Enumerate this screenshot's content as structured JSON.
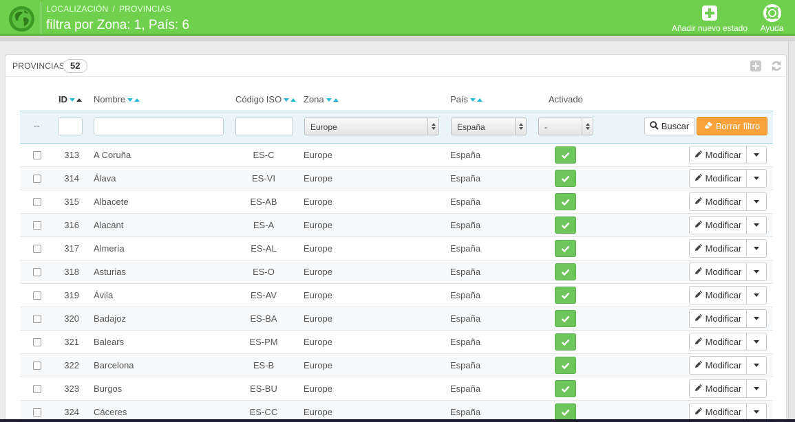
{
  "header": {
    "breadcrumb": [
      "LOCALIZACIÓN",
      "PROVINCIAS"
    ],
    "breadcrumb_sep": "/",
    "title": "filtra por Zona: 1, País: 6",
    "add_label": "Añadir nuevo estado",
    "help_label": "Ayuda",
    "logo_icon": "globe-icon",
    "color": "#6fd04d"
  },
  "panel": {
    "title": "PROVINCIAS",
    "count": "52"
  },
  "table": {
    "headers": {
      "id": "ID",
      "name": "Nombre",
      "iso": "Código ISO",
      "zone": "Zona",
      "country": "País",
      "active": "Activado"
    },
    "filters": {
      "bulk": "--",
      "id": "",
      "name": "",
      "iso": "",
      "zone": "Europe",
      "country": "España",
      "active": "-",
      "search_label": "Buscar",
      "reset_label": "Borrar filtro"
    },
    "edit_label": "Modificar",
    "rows": [
      {
        "id": "313",
        "name": "A Coruña",
        "iso": "ES-C",
        "zone": "Europe",
        "country": "España",
        "active": true
      },
      {
        "id": "314",
        "name": "Álava",
        "iso": "ES-VI",
        "zone": "Europe",
        "country": "España",
        "active": true
      },
      {
        "id": "315",
        "name": "Albacete",
        "iso": "ES-AB",
        "zone": "Europe",
        "country": "España",
        "active": true
      },
      {
        "id": "316",
        "name": "Alacant",
        "iso": "ES-A",
        "zone": "Europe",
        "country": "España",
        "active": true
      },
      {
        "id": "317",
        "name": "Almería",
        "iso": "ES-AL",
        "zone": "Europe",
        "country": "España",
        "active": true
      },
      {
        "id": "318",
        "name": "Asturias",
        "iso": "ES-O",
        "zone": "Europe",
        "country": "España",
        "active": true
      },
      {
        "id": "319",
        "name": "Ávila",
        "iso": "ES-AV",
        "zone": "Europe",
        "country": "España",
        "active": true
      },
      {
        "id": "320",
        "name": "Badajoz",
        "iso": "ES-BA",
        "zone": "Europe",
        "country": "España",
        "active": true
      },
      {
        "id": "321",
        "name": "Balears",
        "iso": "ES-PM",
        "zone": "Europe",
        "country": "España",
        "active": true
      },
      {
        "id": "322",
        "name": "Barcelona",
        "iso": "ES-B",
        "zone": "Europe",
        "country": "España",
        "active": true
      },
      {
        "id": "323",
        "name": "Burgos",
        "iso": "ES-BU",
        "zone": "Europe",
        "country": "España",
        "active": true
      },
      {
        "id": "324",
        "name": "Cáceres",
        "iso": "ES-CC",
        "zone": "Europe",
        "country": "España",
        "active": true
      }
    ]
  }
}
